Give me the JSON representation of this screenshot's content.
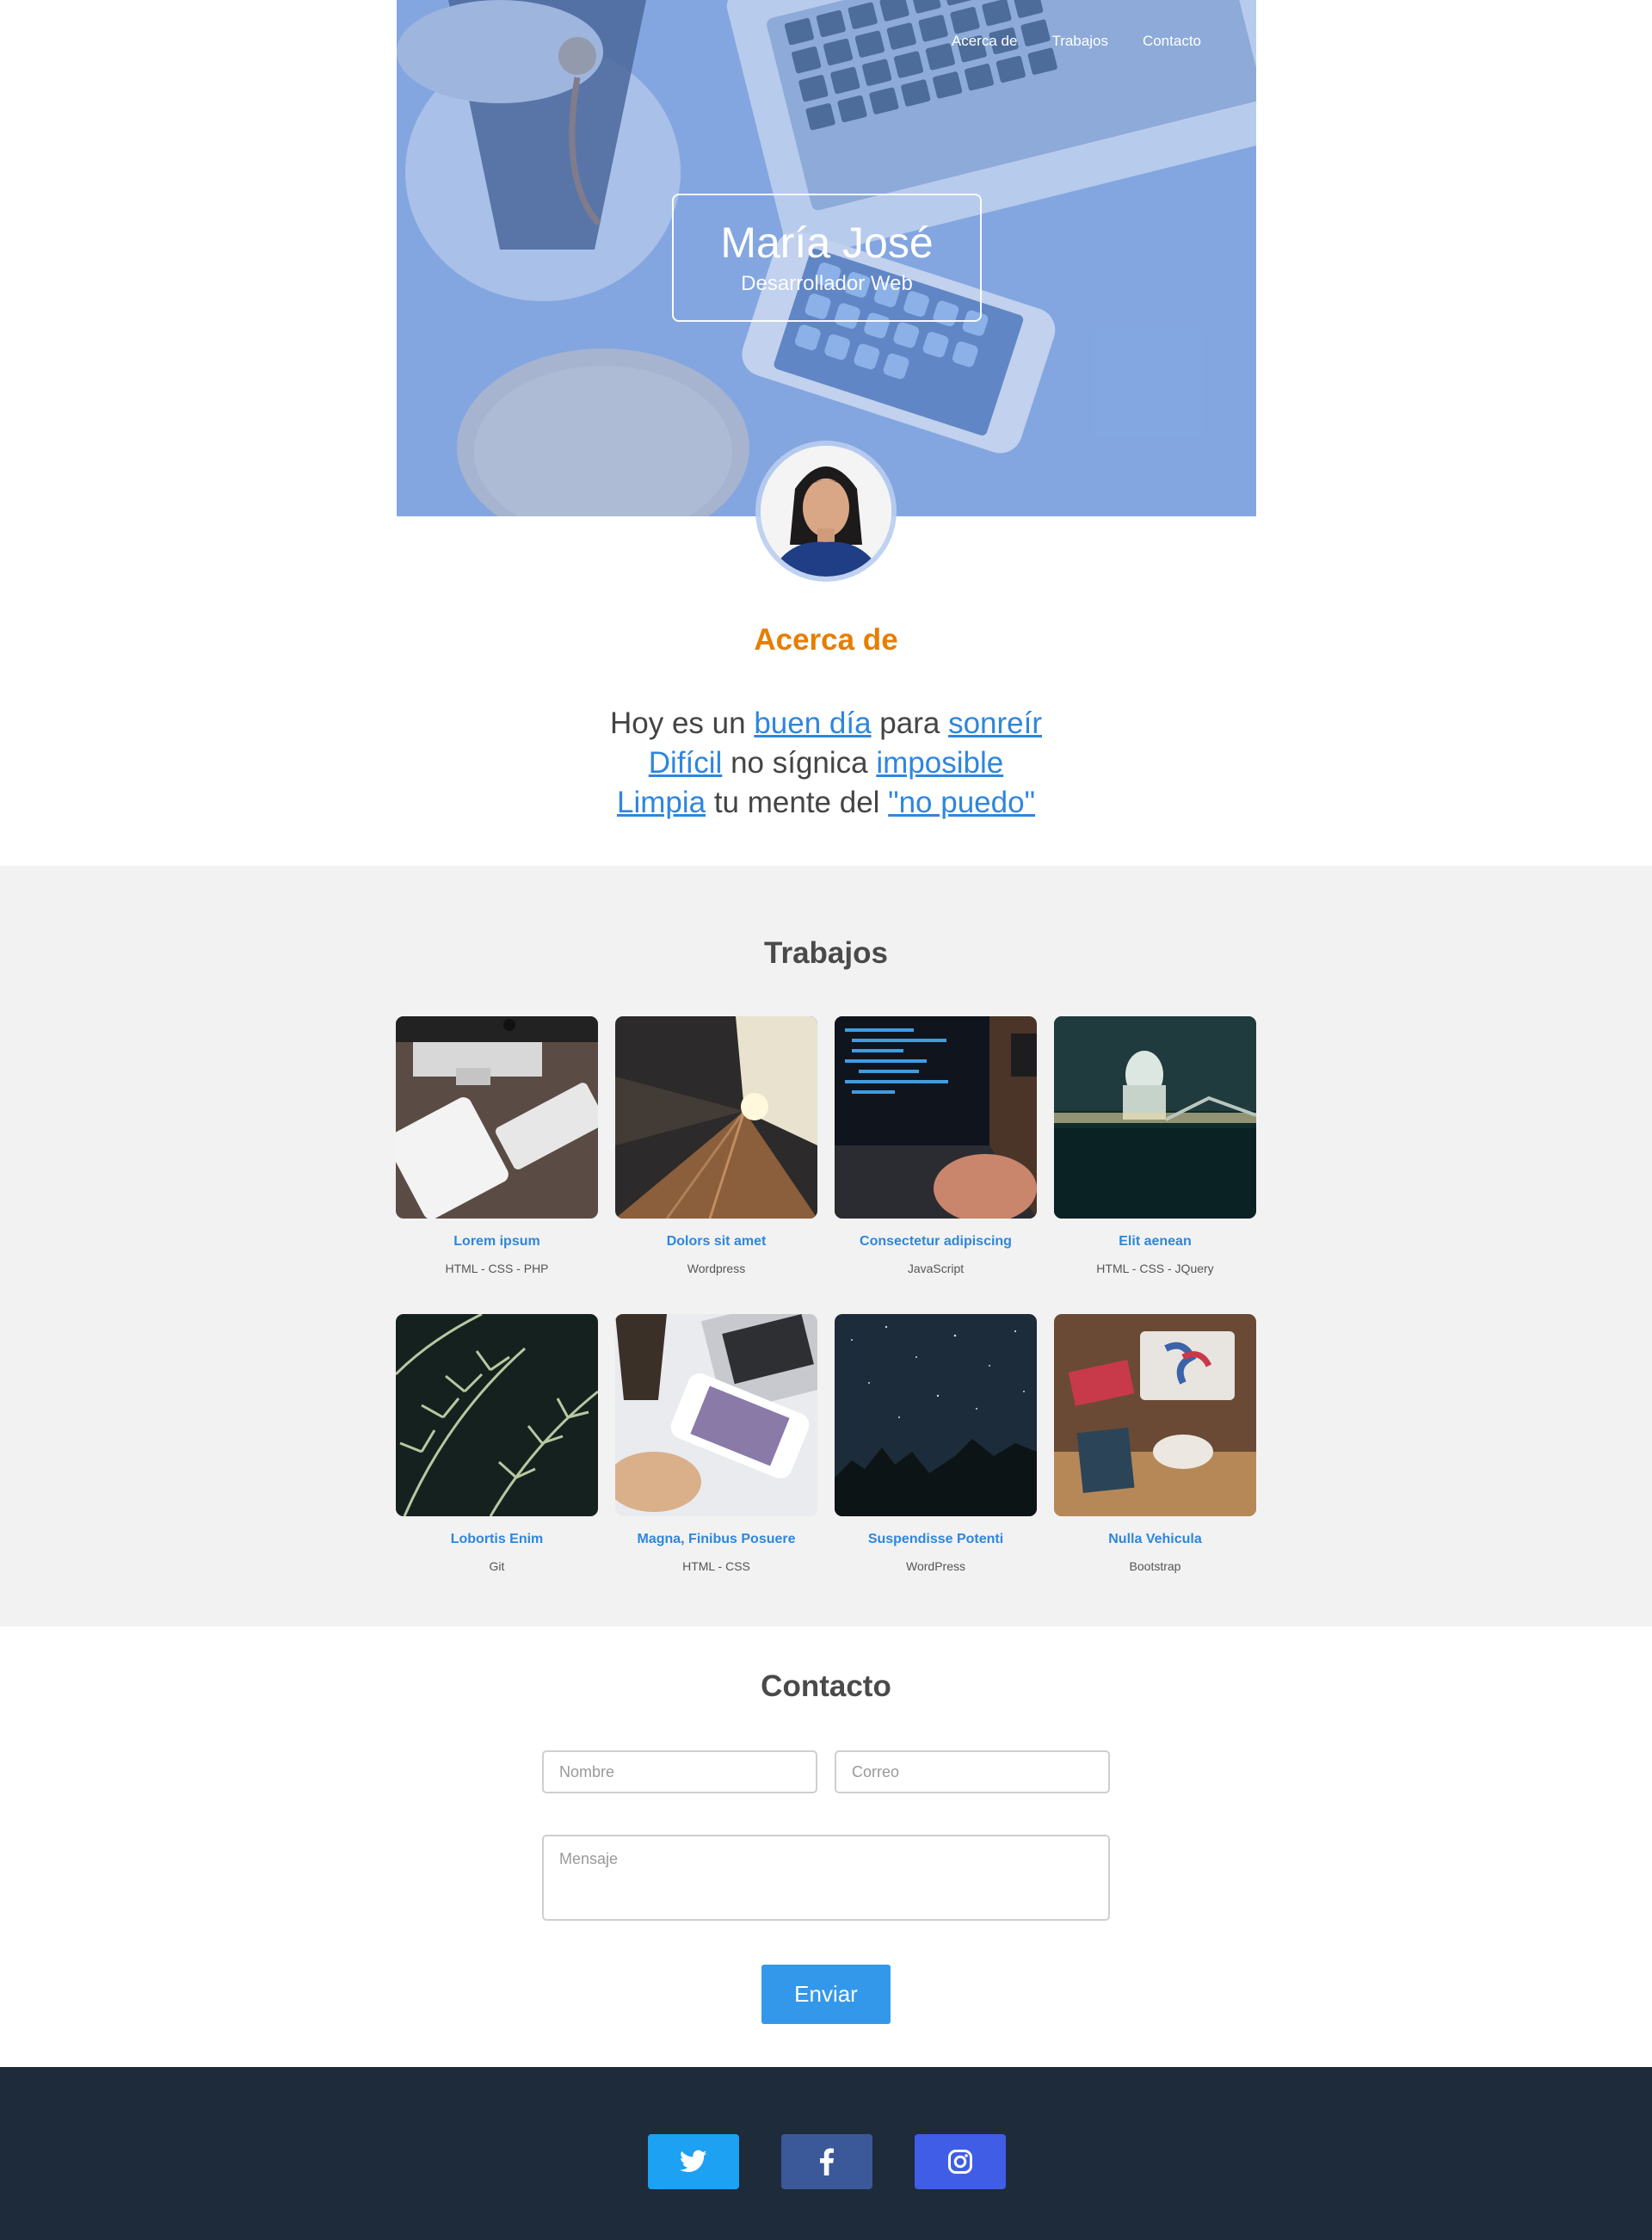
{
  "nav": {
    "items": [
      {
        "label": "Acerca de"
      },
      {
        "label": "Trabajos"
      },
      {
        "label": "Contacto"
      }
    ]
  },
  "hero": {
    "name": "María José",
    "role": "Desarrollador Web"
  },
  "about": {
    "title": "Acerca de",
    "lines": [
      [
        "Hoy es un ",
        "buen día",
        " para ",
        "sonreír"
      ],
      [
        "Difícil",
        " no sígnica ",
        "imposible"
      ],
      [
        "Limpia",
        " tu mente del ",
        "\"no puedo\""
      ]
    ]
  },
  "works": {
    "title": "Trabajos",
    "items": [
      {
        "title": "Lorem ipsum",
        "tags": "HTML - CSS - PHP"
      },
      {
        "title": "Dolors sit amet",
        "tags": "Wordpress"
      },
      {
        "title": "Consectetur adipiscing",
        "tags": "JavaScript"
      },
      {
        "title": "Elit aenean",
        "tags": "HTML - CSS - JQuery"
      },
      {
        "title": "Lobortis Enim",
        "tags": "Git"
      },
      {
        "title": "Magna, Finibus Posuere",
        "tags": "HTML - CSS"
      },
      {
        "title": "Suspendisse Potenti",
        "tags": "WordPress"
      },
      {
        "title": "Nulla Vehicula",
        "tags": "Bootstrap"
      }
    ]
  },
  "contact": {
    "title": "Contacto",
    "name_placeholder": "Nombre",
    "email_placeholder": "Correo",
    "message_placeholder": "Mensaje",
    "submit_label": "Enviar"
  },
  "footer": {
    "social": [
      {
        "icon": "twitter-icon",
        "color": "#1da1f2"
      },
      {
        "icon": "facebook-icon",
        "color": "#3b5998"
      },
      {
        "icon": "instagram-icon",
        "color": "#405de6"
      }
    ]
  },
  "colors": {
    "accent": "#e67e00",
    "link": "#2e86de",
    "button": "#3498ea",
    "footer": "#1e2b3a"
  }
}
